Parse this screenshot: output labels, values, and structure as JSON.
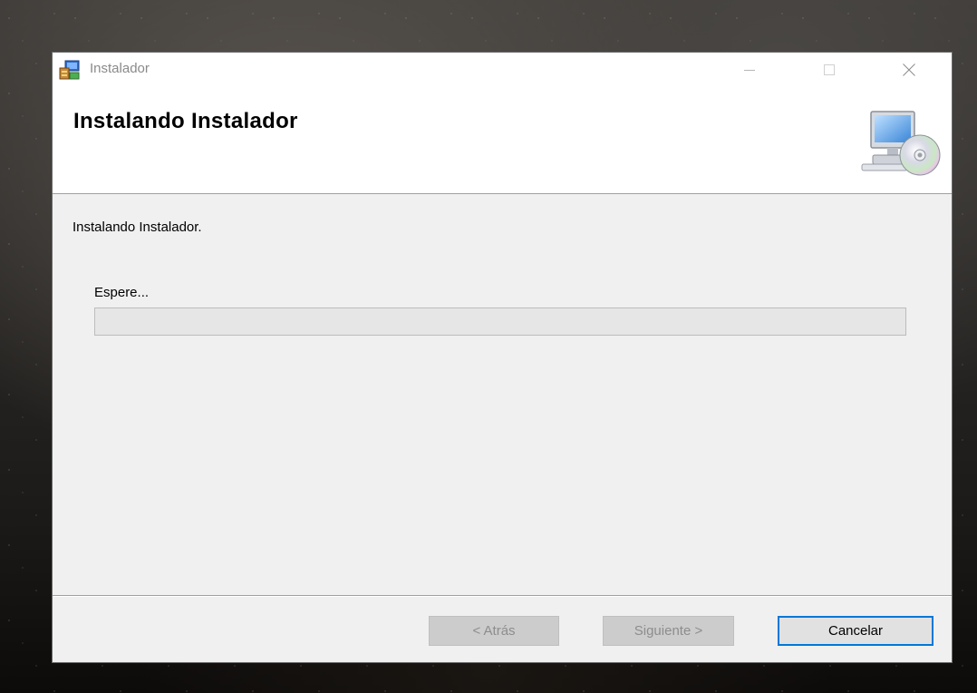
{
  "window": {
    "title": "Instalador",
    "app_icon": "installer-icon",
    "controls": {
      "minimize_icon": "minimize-icon",
      "maximize_icon": "maximize-icon",
      "close_icon": "close-icon"
    }
  },
  "header": {
    "title": "Instalando Instalador",
    "icon": "computer-cd-icon"
  },
  "content": {
    "status": "Instalando Instalador.",
    "wait_label": "Espere...",
    "progress": 0
  },
  "footer": {
    "back_label": "< Atrás",
    "back_enabled": false,
    "next_label": "Siguiente >",
    "next_enabled": false,
    "cancel_label": "Cancelar"
  },
  "colors": {
    "focus_border": "#0078d7",
    "window_bg": "#f0f0f0",
    "disabled_button": "#cccccc",
    "disabled_text": "#8d8d8d"
  }
}
